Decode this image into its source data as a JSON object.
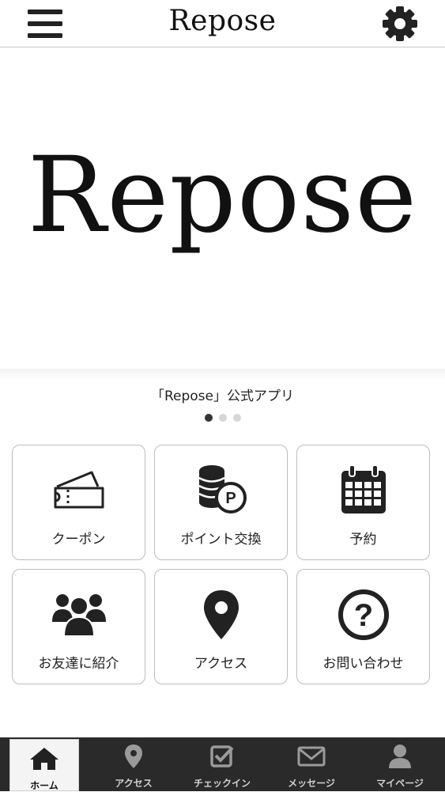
{
  "header": {
    "title": "Repose"
  },
  "hero": {
    "logo_text": "Repose",
    "caption": "「Repose」公式アプリ",
    "slides": 3,
    "active_slide": 0
  },
  "menu": [
    {
      "label": "クーポン",
      "icon": "ticket-icon"
    },
    {
      "label": "ポイント交換",
      "icon": "coins-point-icon"
    },
    {
      "label": "予約",
      "icon": "calendar-icon"
    },
    {
      "label": "お友達に紹介",
      "icon": "group-users-icon"
    },
    {
      "label": "アクセス",
      "icon": "map-pin-icon"
    },
    {
      "label": "お問い合わせ",
      "icon": "question-icon"
    }
  ],
  "tabbar": [
    {
      "label": "ホーム",
      "icon": "home-icon",
      "active": true
    },
    {
      "label": "アクセス",
      "icon": "map-pin-icon",
      "active": false
    },
    {
      "label": "チェックイン",
      "icon": "checkin-icon",
      "active": false
    },
    {
      "label": "メッセージ",
      "icon": "envelope-icon",
      "active": false
    },
    {
      "label": "マイページ",
      "icon": "user-icon",
      "active": false
    }
  ],
  "colors": {
    "tabbar_bg": "#2a2a2a",
    "icon": "#222222",
    "border": "#bdbdbd"
  }
}
